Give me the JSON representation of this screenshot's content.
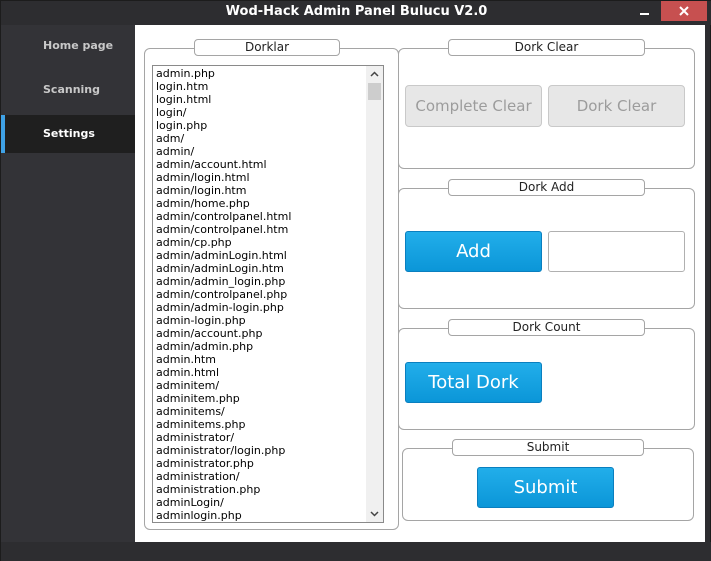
{
  "window": {
    "title": "Wod-Hack Admin Panel Bulucu V2.0"
  },
  "sidebar": {
    "items": [
      {
        "label": "Home page",
        "active": false
      },
      {
        "label": "Scanning",
        "active": false
      },
      {
        "label": "Settings",
        "active": true
      }
    ]
  },
  "dorklar": {
    "label": "Dorklar",
    "items": [
      "admin.php",
      "login.htm",
      "login.html",
      "login/",
      "login.php",
      "adm/",
      "admin/",
      "admin/account.html",
      "admin/login.html",
      "admin/login.htm",
      "admin/home.php",
      "admin/controlpanel.html",
      "admin/controlpanel.htm",
      "admin/cp.php",
      "admin/adminLogin.html",
      "admin/adminLogin.htm",
      "admin/admin_login.php",
      "admin/controlpanel.php",
      "admin/admin-login.php",
      "admin-login.php",
      "admin/account.php",
      "admin/admin.php",
      "admin.htm",
      "admin.html",
      "adminitem/",
      "adminitem.php",
      "adminitems/",
      "adminitems.php",
      "administrator/",
      "administrator/login.php",
      "administrator.php",
      "administration/",
      "administration.php",
      "adminLogin/",
      "adminlogin.php"
    ]
  },
  "dork_clear": {
    "label": "Dork Clear",
    "complete_clear_label": "Complete Clear",
    "dork_clear_label": "Dork Clear"
  },
  "dork_add": {
    "label": "Dork Add",
    "add_label": "Add",
    "input_value": ""
  },
  "dork_count": {
    "label": "Dork Count",
    "total_label": "Total Dork"
  },
  "submit": {
    "label": "Submit",
    "button_label": "Submit"
  },
  "colors": {
    "accent": "#0ea0e0",
    "sidebar_active_marker": "#3fa2e6",
    "close_button": "#c75050"
  }
}
